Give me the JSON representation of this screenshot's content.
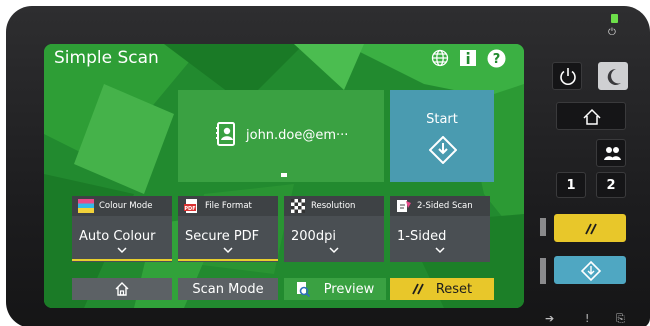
{
  "screen": {
    "title": "Simple Scan",
    "top_icons": [
      "globe-icon",
      "info-icon",
      "help-icon"
    ]
  },
  "destination": {
    "email": "john.doe@em···",
    "icon": "contact-card-icon"
  },
  "start_tile": {
    "label": "Start",
    "icon": "diamond-start-icon"
  },
  "settings": [
    {
      "label": "Colour Mode",
      "value": "Auto Colour",
      "icon": "colour-mode-icon"
    },
    {
      "label": "File Format",
      "value": "Secure PDF",
      "icon": "pdf-icon"
    },
    {
      "label": "Resolution",
      "value": "200dpi",
      "icon": "resolution-icon"
    },
    {
      "label": "2-Sided Scan",
      "value": "1-Sided",
      "icon": "duplex-icon"
    }
  ],
  "bottom_bar": {
    "home_icon": "home-icon",
    "scan_mode": "Scan Mode",
    "preview": "Preview",
    "reset": "Reset"
  },
  "hardware": {
    "button_one": "1",
    "button_two": "2",
    "power_led_color": "#6ddf4a"
  },
  "colors": {
    "accent_yellow": "#e8c72a",
    "start_blue": "#4a9bb0",
    "green": "#3aa142"
  }
}
